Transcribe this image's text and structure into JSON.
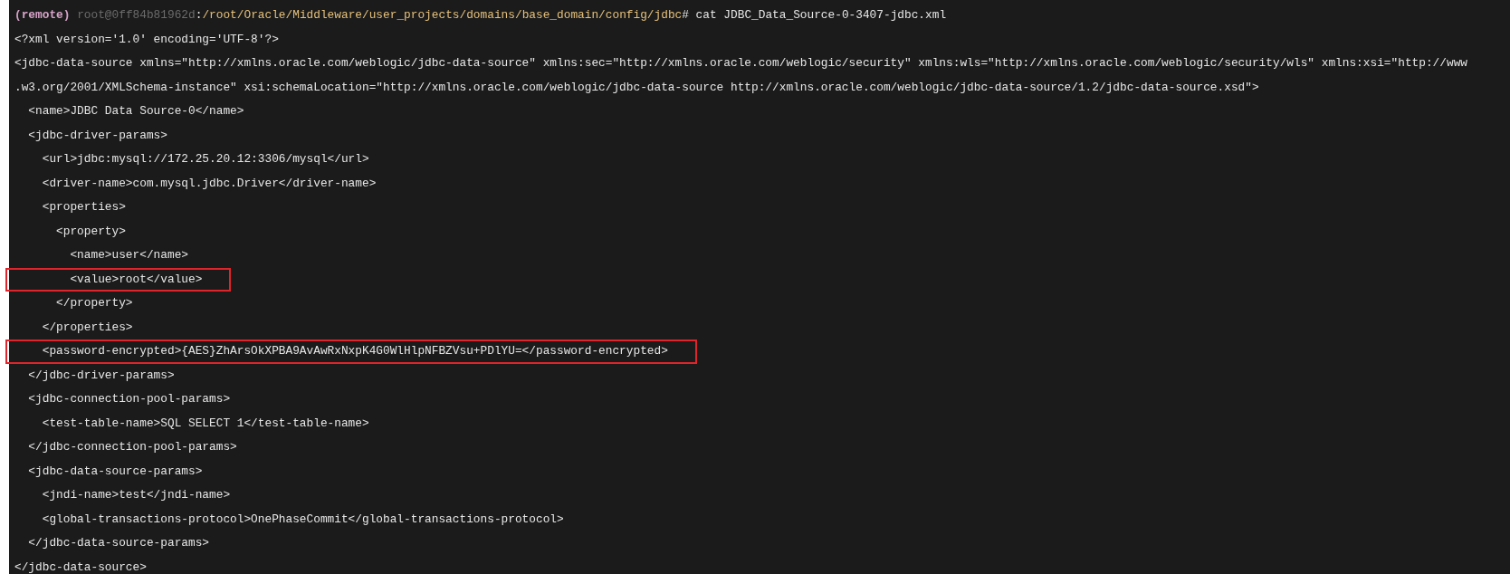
{
  "prompt": {
    "env": "(remote)",
    "host": "root@0ff84b81962d",
    "separator": ":",
    "path": "/root/Oracle/Middleware/user_projects/domains/base_domain/config/jdbc",
    "command": "# cat JDBC_Data_Source-0-3407-jdbc.xml"
  },
  "lines": [
    {
      "text": "<?xml version='1.0' encoding='UTF-8'?>",
      "highlighted": false
    },
    {
      "text": "<jdbc-data-source xmlns=\"http://xmlns.oracle.com/weblogic/jdbc-data-source\" xmlns:sec=\"http://xmlns.oracle.com/weblogic/security\" xmlns:wls=\"http://xmlns.oracle.com/weblogic/security/wls\" xmlns:xsi=\"http://www",
      "highlighted": false
    },
    {
      "text": ".w3.org/2001/XMLSchema-instance\" xsi:schemaLocation=\"http://xmlns.oracle.com/weblogic/jdbc-data-source http://xmlns.oracle.com/weblogic/jdbc-data-source/1.2/jdbc-data-source.xsd\">",
      "highlighted": false
    },
    {
      "text": "  <name>JDBC Data Source-0</name>",
      "highlighted": false
    },
    {
      "text": "  <jdbc-driver-params>",
      "highlighted": false
    },
    {
      "text": "    <url>jdbc:mysql://172.25.20.12:3306/mysql</url>",
      "highlighted": false
    },
    {
      "text": "    <driver-name>com.mysql.jdbc.Driver</driver-name>",
      "highlighted": false
    },
    {
      "text": "    <properties>",
      "highlighted": false
    },
    {
      "text": "      <property>",
      "highlighted": false
    },
    {
      "text": "        <name>user</name>",
      "highlighted": false
    },
    {
      "text": "        <value>root</value>",
      "highlighted": true
    },
    {
      "text": "      </property>",
      "highlighted": false
    },
    {
      "text": "    </properties>",
      "highlighted": false
    },
    {
      "text": "    <password-encrypted>{AES}ZhArsOkXPBA9AvAwRxNxpK4G0WlHlpNFBZVsu+PDlYU=</password-encrypted>",
      "highlighted": true
    },
    {
      "text": "  </jdbc-driver-params>",
      "highlighted": false
    },
    {
      "text": "  <jdbc-connection-pool-params>",
      "highlighted": false
    },
    {
      "text": "    <test-table-name>SQL SELECT 1</test-table-name>",
      "highlighted": false
    },
    {
      "text": "  </jdbc-connection-pool-params>",
      "highlighted": false
    },
    {
      "text": "  <jdbc-data-source-params>",
      "highlighted": false
    },
    {
      "text": "    <jndi-name>test</jndi-name>",
      "highlighted": false
    },
    {
      "text": "    <global-transactions-protocol>OnePhaseCommit</global-transactions-protocol>",
      "highlighted": false
    },
    {
      "text": "  </jdbc-data-source-params>",
      "highlighted": false
    },
    {
      "text": "</jdbc-data-source>",
      "highlighted": false
    }
  ]
}
